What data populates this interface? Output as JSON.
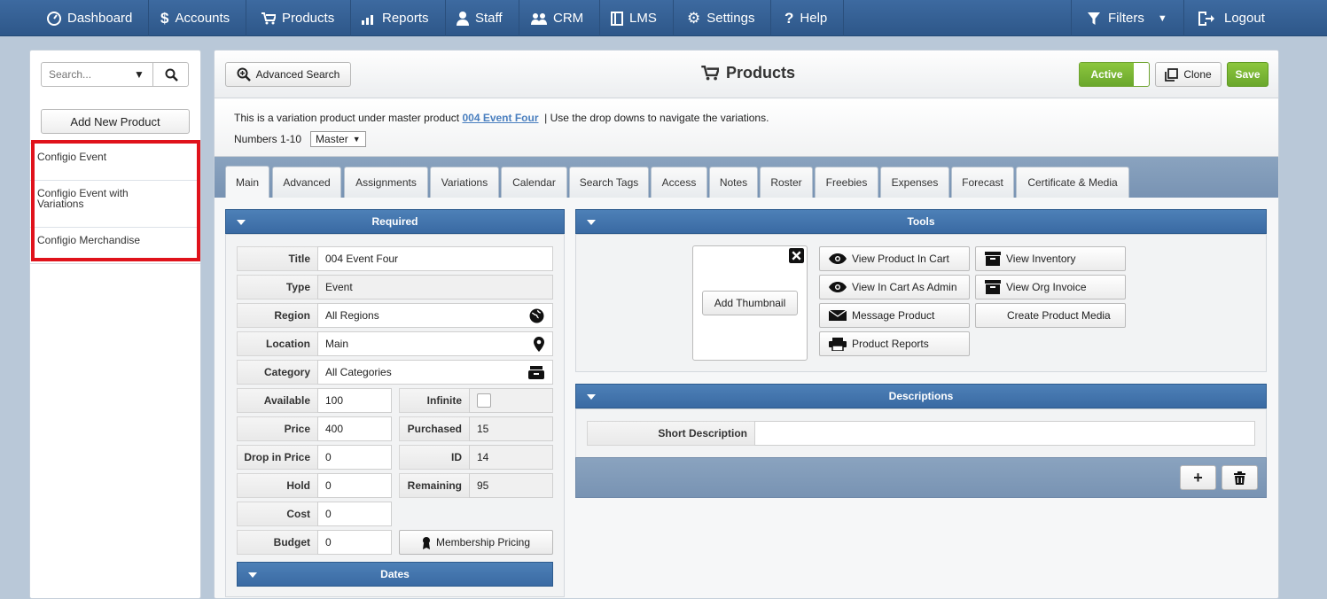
{
  "nav": {
    "items": [
      {
        "label": "Dashboard",
        "icon": "dashboard-icon"
      },
      {
        "label": "Accounts",
        "icon": "dollar-icon"
      },
      {
        "label": "Products",
        "icon": "cart-icon"
      },
      {
        "label": "Reports",
        "icon": "chart-icon"
      },
      {
        "label": "Staff",
        "icon": "person-icon"
      },
      {
        "label": "CRM",
        "icon": "people-icon"
      },
      {
        "label": "LMS",
        "icon": "book-icon"
      },
      {
        "label": "Settings",
        "icon": "gear-icon"
      },
      {
        "label": "Help",
        "icon": "question-icon"
      }
    ],
    "filters": "Filters",
    "logout": "Logout"
  },
  "sidebar": {
    "search_placeholder": "Search...",
    "add_new": "Add New Product",
    "items": [
      {
        "label": "Configio Event"
      },
      {
        "label": "Configio Event with Variations"
      },
      {
        "label": "Configio Merchandise"
      }
    ]
  },
  "header": {
    "advanced_search": "Advanced Search",
    "title": "Products",
    "active": "Active",
    "clone": "Clone",
    "save": "Save"
  },
  "info": {
    "line1_prefix": "This is a variation product under master product",
    "master_link": "004 Event Four",
    "line1_suffix": "|  Use the drop downs to navigate the variations.",
    "numbers_label": "Numbers 1-10",
    "master_select": "Master"
  },
  "tabs": [
    "Main",
    "Advanced",
    "Assignments",
    "Variations",
    "Calendar",
    "Search Tags",
    "Access",
    "Notes",
    "Roster",
    "Freebies",
    "Expenses",
    "Forecast",
    "Certificate & Media"
  ],
  "required": {
    "heading": "Required",
    "title_label": "Title",
    "title_value": "004 Event Four",
    "type_label": "Type",
    "type_value": "Event",
    "region_label": "Region",
    "region_value": "All Regions",
    "location_label": "Location",
    "location_value": "Main",
    "category_label": "Category",
    "category_value": "All Categories",
    "available_label": "Available",
    "available_value": "100",
    "infinite_label": "Infinite",
    "price_label": "Price",
    "price_value": "400",
    "purchased_label": "Purchased",
    "purchased_value": "15",
    "drop_label": "Drop in Price",
    "drop_value": "0",
    "id_label": "ID",
    "id_value": "14",
    "hold_label": "Hold",
    "hold_value": "0",
    "remaining_label": "Remaining",
    "remaining_value": "95",
    "cost_label": "Cost",
    "cost_value": "0",
    "budget_label": "Budget",
    "budget_value": "0",
    "membership_pricing": "Membership Pricing",
    "dates_heading": "Dates"
  },
  "tools": {
    "heading": "Tools",
    "add_thumbnail": "Add Thumbnail",
    "view_cart": "View Product In Cart",
    "view_cart_admin": "View In Cart As Admin",
    "message_product": "Message Product",
    "product_reports": "Product Reports",
    "view_inventory": "View Inventory",
    "view_org_invoice": "View Org Invoice",
    "create_media": "Create Product Media"
  },
  "descriptions": {
    "heading": "Descriptions",
    "short_label": "Short Description",
    "short_value": ""
  },
  "colors": {
    "nav_bg": "#2e5789",
    "panel_head": "#3f70a8",
    "active_green": "#7ab535",
    "highlight_red": "#e0121b"
  }
}
